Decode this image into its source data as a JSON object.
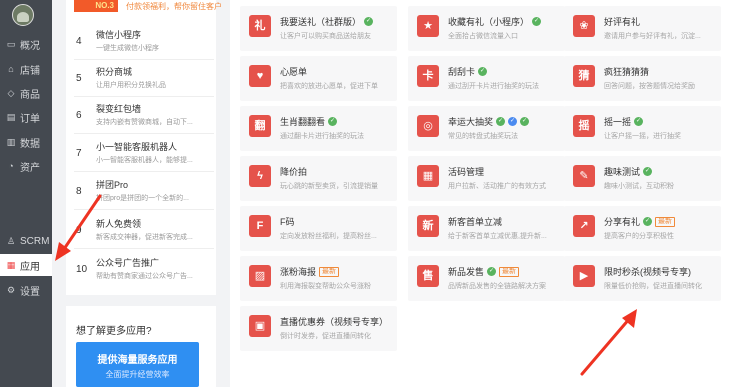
{
  "sidebar": {
    "items": [
      {
        "label": "概况",
        "icon": "monitor-icon",
        "glyph": "▭"
      },
      {
        "label": "店铺",
        "icon": "store-icon",
        "glyph": "⌂"
      },
      {
        "label": "商品",
        "icon": "tag-icon",
        "glyph": "◇"
      },
      {
        "label": "订单",
        "icon": "order-icon",
        "glyph": "▤"
      },
      {
        "label": "数据",
        "icon": "chart-icon",
        "glyph": "▥"
      },
      {
        "label": "资产",
        "icon": "wallet-icon",
        "glyph": "◔"
      },
      {
        "label": "SCRM",
        "icon": "user-icon",
        "glyph": "♙"
      },
      {
        "label": "应用",
        "icon": "apps-icon",
        "glyph": "▦"
      },
      {
        "label": "设置",
        "icon": "gear-icon",
        "glyph": "⚙"
      }
    ]
  },
  "mid": {
    "promo_tag": "NO.3",
    "promo_text": "付款领福利，帮你留住客户",
    "rows": [
      {
        "num": "4",
        "title": "微信小程序",
        "desc": "一键生成微信小程序"
      },
      {
        "num": "5",
        "title": "积分商城",
        "desc": "让用户用积分兑换礼品"
      },
      {
        "num": "6",
        "title": "裂变红包墙",
        "desc": "支持内嵌有赞微商城，自动下..."
      },
      {
        "num": "7",
        "title": "小一智能客服机器人",
        "desc": "小一智能客服机器人，能够提..."
      },
      {
        "num": "8",
        "title": "拼团Pro",
        "desc": "拼团pro是拼团的一个全新的..."
      },
      {
        "num": "9",
        "title": "新人免费领",
        "desc": "新客成交神器，促进新客完成..."
      },
      {
        "num": "10",
        "title": "公众号广告推广",
        "desc": "帮助有赞商家通过公众号广告..."
      }
    ],
    "more_heading": "想了解更多应用?",
    "service_button": "提供海量服务应用",
    "service_sub": "全面提升经营效率"
  },
  "cards": [
    {
      "title": "我要送礼（社群版）",
      "desc": "让客户可以购买商品送给朋友",
      "glyph": "礼",
      "color": "#e5534b",
      "badges": [
        "v"
      ]
    },
    {
      "title": "收藏有礼（小程序）",
      "desc": "全面拾占微信流量入口",
      "glyph": "★",
      "color": "#e5534b",
      "badges": [
        "v"
      ]
    },
    {
      "title": "好评有礼",
      "desc": "邀请用户参与好评有礼，沉淀...",
      "glyph": "❀",
      "color": "#e5534b",
      "badges": []
    },
    {
      "title": "心愿单",
      "desc": "把喜欢的放进心愿单，促进下单",
      "glyph": "♥",
      "color": "#e5534b",
      "badges": []
    },
    {
      "title": "刮刮卡",
      "desc": "通过刮开卡片进行抽奖的玩法",
      "glyph": "卡",
      "color": "#e5534b",
      "badges": [
        "v"
      ]
    },
    {
      "title": "疯狂猜猜猜",
      "desc": "回答问题，按答题情况给奖励",
      "glyph": "猜",
      "color": "#e5534b",
      "badges": []
    },
    {
      "title": "生肖翻翻看",
      "desc": "通过翻卡片进行抽奖的玩法",
      "glyph": "翻",
      "color": "#e5534b",
      "badges": [
        "v"
      ]
    },
    {
      "title": "幸运大抽奖",
      "desc": "常见的转盘式抽奖玩法",
      "glyph": "◎",
      "color": "#e5534b",
      "badges": [
        "v",
        "b",
        "v"
      ]
    },
    {
      "title": "摇一摇",
      "desc": "让客户摇一摇，进行抽奖",
      "glyph": "摇",
      "color": "#e5534b",
      "badges": [
        "v"
      ]
    },
    {
      "title": "降价拍",
      "desc": "玩心跳的新型卖货，引流提销量",
      "glyph": "ϟ",
      "color": "#e5534b",
      "badges": []
    },
    {
      "title": "活码管理",
      "desc": "用户拉新、活动推广的有效方式",
      "glyph": "▦",
      "color": "#e5534b",
      "badges": []
    },
    {
      "title": "趣味测试",
      "desc": "趣味小测试，互动积粉",
      "glyph": "✎",
      "color": "#e5534b",
      "badges": [
        "v"
      ]
    },
    {
      "title": "F码",
      "desc": "定向发放粉丝福利，提高粉丝...",
      "glyph": "F",
      "color": "#e5534b",
      "badges": []
    },
    {
      "title": "新客首单立减",
      "desc": "给于新客首单立减优惠,提升新...",
      "glyph": "新",
      "color": "#e5534b",
      "badges": []
    },
    {
      "title": "分享有礼",
      "desc": "提高客户的分享积极性",
      "glyph": "↗",
      "color": "#e5534b",
      "badges": [
        "v",
        "new"
      ]
    },
    {
      "title": "涨粉海报",
      "desc": "利用海报裂变帮助公众号涨粉",
      "glyph": "▨",
      "color": "#e5534b",
      "badges": [
        "new"
      ]
    },
    {
      "title": "新品发售",
      "desc": "品牌新品发售的全链路解决方案",
      "glyph": "售",
      "color": "#e5534b",
      "badges": [
        "v",
        "new"
      ]
    },
    {
      "title": "限时秒杀(视频号专享)",
      "desc": "限量低价抢购，促进直播间转化",
      "glyph": "▶",
      "color": "#e5534b",
      "badges": []
    },
    {
      "title": "直播优惠券（视频号专享）",
      "desc": "倒计时发券，促进直播间转化",
      "glyph": "▣",
      "color": "#e5534b",
      "badges": []
    }
  ],
  "badge_text": {
    "v": "✓",
    "new": "最新"
  },
  "colors": {
    "accent": "#e5534b",
    "sidebar": "#444950",
    "button": "#2f8ff2",
    "arrow": "#ee3322"
  }
}
